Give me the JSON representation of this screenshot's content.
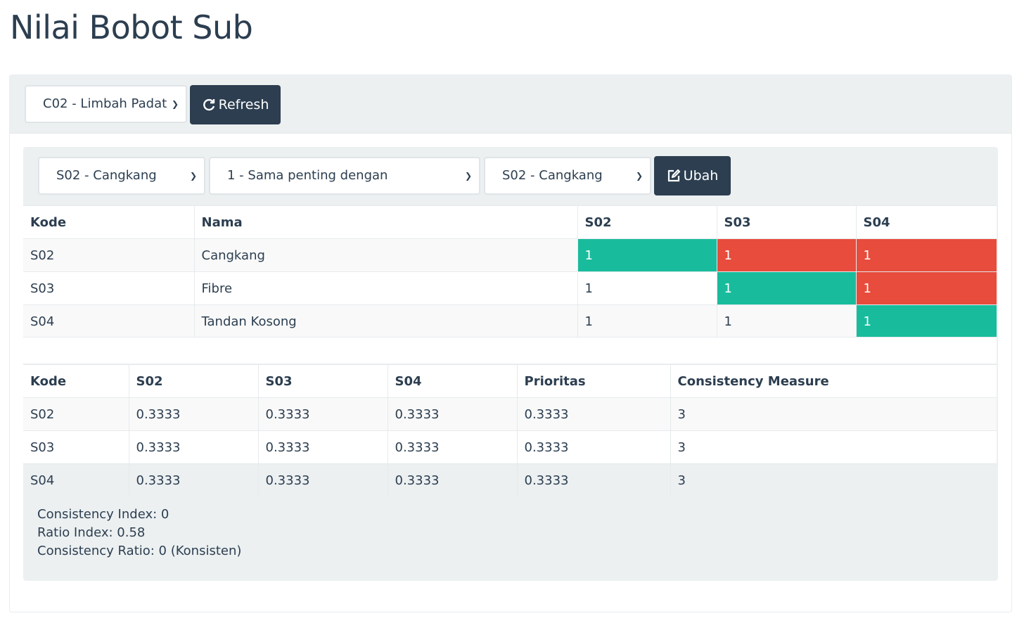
{
  "page": {
    "title": "Nilai Bobot Sub"
  },
  "filter": {
    "criteria_select": "C02 - Limbah Padat",
    "refresh_label": "Refresh"
  },
  "editor": {
    "left_select": "S02 - Cangkang",
    "scale_select": "1 - Sama penting dengan",
    "right_select": "S02 - Cangkang",
    "update_label": "Ubah"
  },
  "comparison_table": {
    "headers": [
      "Kode",
      "Nama",
      "S02",
      "S03",
      "S04"
    ],
    "rows": [
      {
        "kode": "S02",
        "nama": "Cangkang",
        "s02": "1",
        "s03": "1",
        "s04": "1"
      },
      {
        "kode": "S03",
        "nama": "Fibre",
        "s02": "1",
        "s03": "1",
        "s04": "1"
      },
      {
        "kode": "S04",
        "nama": "Tandan Kosong",
        "s02": "1",
        "s03": "1",
        "s04": "1"
      }
    ]
  },
  "priority_table": {
    "headers": [
      "Kode",
      "S02",
      "S03",
      "S04",
      "Prioritas",
      "Consistency Measure"
    ],
    "rows": [
      {
        "kode": "S02",
        "s02": "0.3333",
        "s03": "0.3333",
        "s04": "0.3333",
        "prioritas": "0.3333",
        "cm": "3"
      },
      {
        "kode": "S03",
        "s02": "0.3333",
        "s03": "0.3333",
        "s04": "0.3333",
        "prioritas": "0.3333",
        "cm": "3"
      },
      {
        "kode": "S04",
        "s02": "0.3333",
        "s03": "0.3333",
        "s04": "0.3333",
        "prioritas": "0.3333",
        "cm": "3"
      }
    ]
  },
  "consistency": {
    "index": "Consistency Index: 0",
    "ratio_index": "Ratio Index: 0.58",
    "ratio": "Consistency Ratio: 0 (Konsisten)"
  },
  "colors": {
    "primary": "#2c3e50",
    "diagonal": "#18bc9c",
    "upper": "#e74c3c",
    "panel": "#ecf0f1"
  }
}
